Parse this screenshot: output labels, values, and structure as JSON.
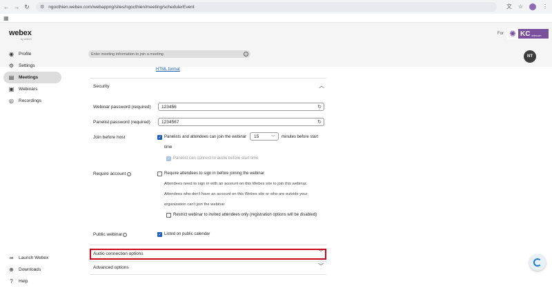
{
  "browser": {
    "url": "ngocthien.webex.com/webappng/sites/ngocthien/meeting/schedulerEvent",
    "back_icon": "←",
    "forward_icon": "→",
    "reload_icon": "↻"
  },
  "header": {
    "logo": "webex",
    "logo_sub": "by CISCO",
    "for_label": "For",
    "org_logo_text": "KC",
    "org_logo_sub": "telecom",
    "search_placeholder": "Enter meeting information to join a meeting",
    "avatar_initials": "NT"
  },
  "sidebar": {
    "items": [
      {
        "label": "Profile",
        "icon": "person-icon"
      },
      {
        "label": "Settings",
        "icon": "gear-icon"
      },
      {
        "label": "Meetings",
        "icon": "calendar-icon",
        "active": true
      },
      {
        "label": "Webinars",
        "icon": "webinar-icon"
      },
      {
        "label": "Recordings",
        "icon": "record-icon"
      }
    ],
    "bottom_items": [
      {
        "label": "Launch Webex",
        "icon": "webex-icon"
      },
      {
        "label": "Downloads",
        "icon": "download-icon"
      },
      {
        "label": "Help",
        "icon": "help-icon"
      }
    ]
  },
  "form": {
    "html_format_link": "HTML format",
    "security": {
      "title": "Security",
      "webinar_password_label": "Webinar password (required)",
      "webinar_password_value": "123456",
      "panelist_password_label": "Panelist password (required)",
      "panelist_password_value": "1234567",
      "join_before_host_label": "Join before host",
      "join_before_host_text": "Panelists and attendees can join the webinar",
      "join_before_minutes": "15",
      "minutes_text": "minutes before start",
      "time_text": "time",
      "panelist_audio_text": "Panelist can connect to audio before start time",
      "require_account_label": "Require account",
      "require_account_text": "Require attendees to sign in before joining the webinar",
      "require_help_1": "Attendees need to sign in with an account on this Webex site to join this webinar.",
      "require_help_2": "Attendees who don't have an account on this Webex site or who are outside your",
      "require_help_3": "organization can't join the webinar.",
      "restrict_text": "Restrict webinar to invited attendees only (registration options will be disabled)",
      "public_webinar_label": "Public webinar",
      "public_webinar_text": "Listed on public calendar"
    },
    "audio_options": "Audio connection options",
    "advanced_options": "Advanced options"
  }
}
